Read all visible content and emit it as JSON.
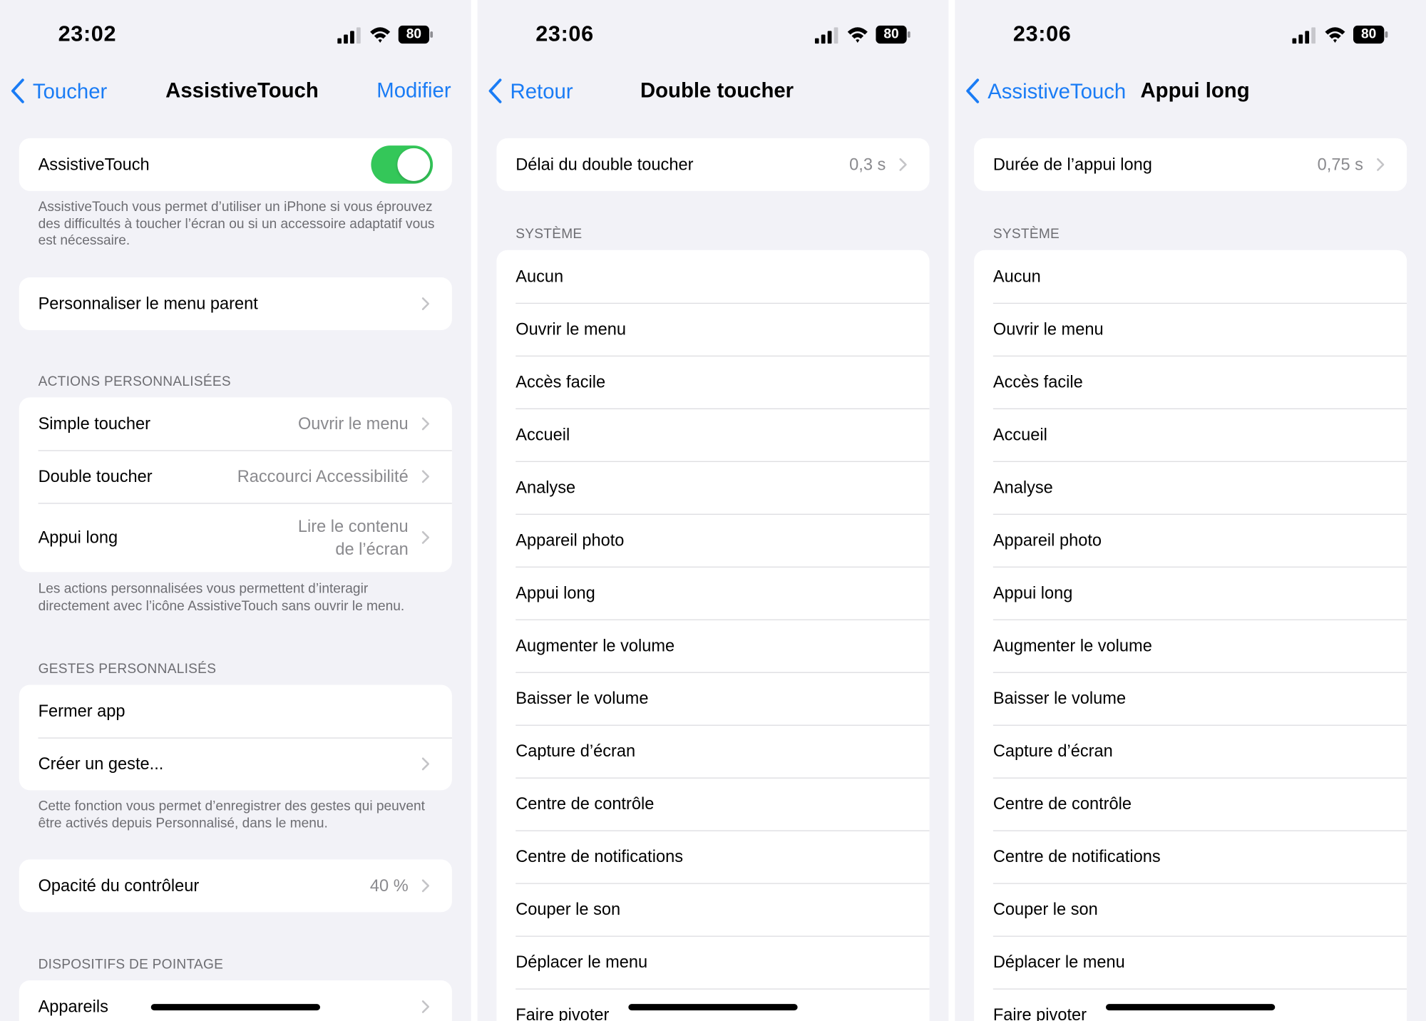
{
  "screens": [
    {
      "status": {
        "time": "23:02",
        "battery": "80"
      },
      "nav": {
        "back": "Toucher",
        "title": "AssistiveTouch",
        "right": "Modifier"
      },
      "toggle_row": {
        "label": "AssistiveTouch",
        "on": true
      },
      "toggle_footer": "AssistiveTouch vous permet d’utiliser un iPhone si vous éprouvez des difficultés à toucher l’écran ou si un accessoire adaptatif vous est nécessaire.",
      "menu_row": {
        "label": "Personnaliser le menu parent"
      },
      "actions_header": "ACTIONS PERSONNALISÉES",
      "actions": [
        {
          "label": "Simple toucher",
          "value": "Ouvrir le menu"
        },
        {
          "label": "Double toucher",
          "value": "Raccourci Accessibilité"
        },
        {
          "label": "Appui long",
          "value_line1": "Lire le contenu",
          "value_line2": "de l’écran"
        }
      ],
      "actions_footer": "Les actions personnalisées vous permettent d’interagir directement avec l’icône AssistiveTouch sans ouvrir le menu.",
      "gestures_header": "GESTES PERSONNALISÉS",
      "gestures": [
        {
          "label": "Fermer app"
        },
        {
          "label": "Créer un geste..."
        }
      ],
      "gestures_footer": "Cette fonction vous permet d’enregistrer des gestes qui peuvent être activés depuis Personnalisé, dans le menu.",
      "opacity_row": {
        "label": "Opacité du contrôleur",
        "value": "40 %"
      },
      "pointing_header": "DISPOSITIFS DE POINTAGE",
      "devices_row": {
        "label": "Appareils"
      }
    },
    {
      "status": {
        "time": "23:06",
        "battery": "80"
      },
      "nav": {
        "back": "Retour",
        "title": "Double toucher"
      },
      "delay_row": {
        "label": "Délai du double toucher",
        "value": "0,3 s"
      },
      "system_header": "SYSTÈME",
      "options": [
        "Aucun",
        "Ouvrir le menu",
        "Accès facile",
        "Accueil",
        "Analyse",
        "Appareil photo",
        "Appui long",
        "Augmenter le volume",
        "Baisser le volume",
        "Capture d’écran",
        "Centre de contrôle",
        "Centre de notifications",
        "Couper le son",
        "Déplacer le menu",
        "Faire pivoter"
      ]
    },
    {
      "status": {
        "time": "23:06",
        "battery": "80"
      },
      "nav": {
        "back": "AssistiveTouch",
        "title": "Appui long"
      },
      "duration_row": {
        "label": "Durée de l’appui long",
        "value": "0,75 s"
      },
      "system_header": "SYSTÈME",
      "options": [
        "Aucun",
        "Ouvrir le menu",
        "Accès facile",
        "Accueil",
        "Analyse",
        "Appareil photo",
        "Appui long",
        "Augmenter le volume",
        "Baisser le volume",
        "Capture d’écran",
        "Centre de contrôle",
        "Centre de notifications",
        "Couper le son",
        "Déplacer le menu",
        "Faire pivoter"
      ]
    }
  ],
  "colors": {
    "accent": "#1a7cf5",
    "toggle_on": "#34c759",
    "background": "#f2f2f7",
    "secondary_text": "#8a8a8e"
  }
}
